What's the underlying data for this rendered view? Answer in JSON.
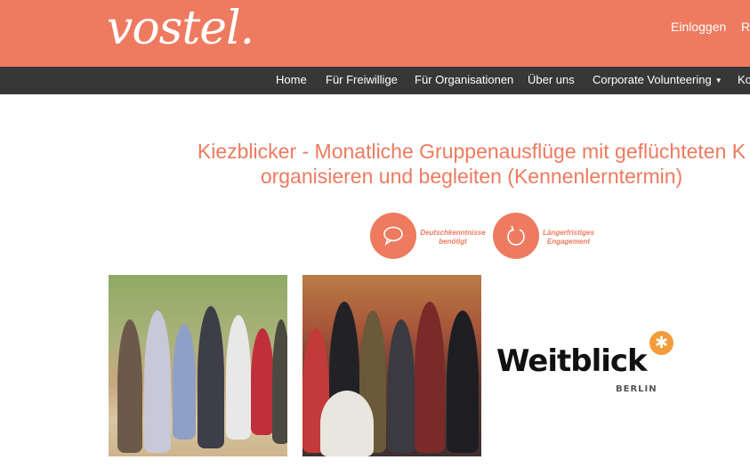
{
  "header": {
    "logo": "vostel.",
    "login": "Einloggen",
    "register": "Re"
  },
  "nav": {
    "items": [
      "Home",
      "Für Freiwillige",
      "Für Organisationen",
      "Über uns",
      "Corporate Volunteering",
      "Ko"
    ]
  },
  "title": {
    "line1": "Kiezblicker - Monatliche Gruppenausflüge mit geflüchteten K",
    "line2": "organisieren und begleiten (Kennenlerntermin)"
  },
  "badges": [
    {
      "icon": "speech-bubble-icon",
      "line1": "Deutschkenntnisse",
      "line2": "benötigt"
    },
    {
      "icon": "refresh-icon",
      "line1": "Längerfristiges",
      "line2": "Engagement"
    }
  ],
  "partner": {
    "name": "Weitblick",
    "city": "BERLIN"
  },
  "colors": {
    "brand": "#ee7a5f",
    "nav": "#373737",
    "accent": "#f39c3a"
  }
}
